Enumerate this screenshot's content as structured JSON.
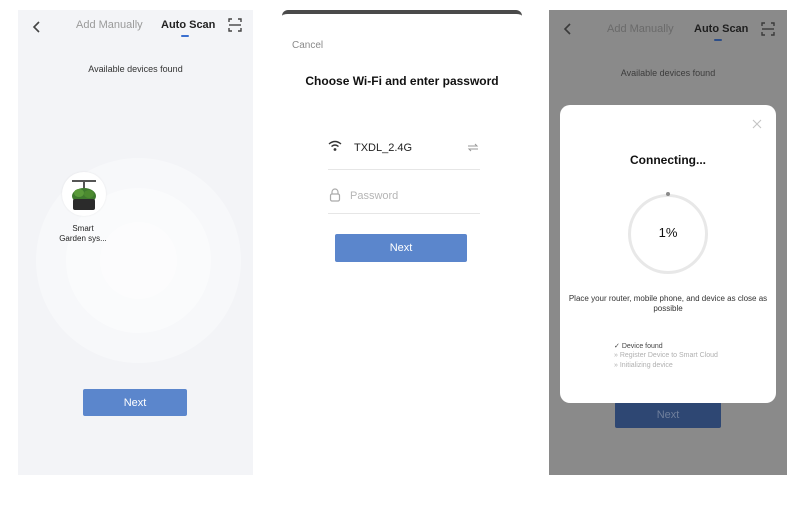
{
  "screen1": {
    "tabs": {
      "manual": "Add Manually",
      "auto": "Auto Scan"
    },
    "icons": {
      "back": "back-chevron",
      "scan": "scan-frame"
    },
    "subtitle": "Available devices found",
    "device": {
      "name_line1": "Smart",
      "name_line2": "Garden sys..."
    },
    "next_label": "Next"
  },
  "screen2": {
    "cancel_label": "Cancel",
    "title": "Choose Wi-Fi and enter password",
    "wifi_name": "TXDL_2.4G",
    "password_placeholder": "Password",
    "next_label": "Next",
    "icons": {
      "wifi": "wifi-icon",
      "switch": "switch-icon",
      "lock": "lock-icon"
    }
  },
  "screen3": {
    "tabs": {
      "manual": "Add Manually",
      "auto": "Auto Scan"
    },
    "subtitle": "Available devices found",
    "dialog": {
      "title": "Connecting...",
      "progress": "1%",
      "progress_value": 0.01,
      "hint": "Place your router, mobile phone, and device as close as possible",
      "steps": [
        {
          "label": "Device found",
          "done": true
        },
        {
          "label": "Register Device to Smart Cloud",
          "done": false
        },
        {
          "label": "Initializing device",
          "done": false
        }
      ]
    },
    "next_label": "Next"
  },
  "colors": {
    "accent": "#5b86cc",
    "tab_underline": "#3a6fcf",
    "panel_bg": "#f3f4f7",
    "overlay_bg": "#8a8a8a"
  }
}
